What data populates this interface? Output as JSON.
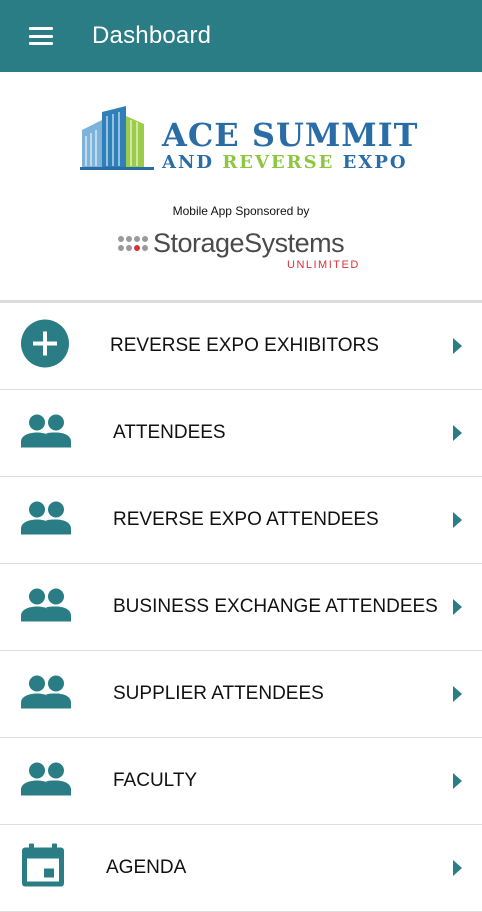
{
  "appbar": {
    "title": "Dashboard",
    "menu_icon": "hamburger-menu-icon",
    "background": "#2a7d85"
  },
  "banner": {
    "logo_title": "ACE SUMMIT",
    "logo_sub_and": "AND",
    "logo_sub_reverse": "REVERSE",
    "logo_sub_expo": "EXPO",
    "sponsor_label": "Mobile App Sponsored by",
    "sponsor_name": "StorageSystems",
    "sponsor_sub": "UNLIMITED",
    "colors": {
      "blue": "#2a6da6",
      "green": "#8dc63f",
      "red": "#d9303a"
    }
  },
  "menu": {
    "items": [
      {
        "label": "REVERSE EXPO EXHIBITORS",
        "icon": "add-circle-icon"
      },
      {
        "label": "ATTENDEES",
        "icon": "people-icon"
      },
      {
        "label": "REVERSE EXPO ATTENDEES",
        "icon": "people-icon"
      },
      {
        "label": "BUSINESS EXCHANGE ATTENDEES",
        "icon": "people-icon"
      },
      {
        "label": "SUPPLIER ATTENDEES",
        "icon": "people-icon"
      },
      {
        "label": "FACULTY",
        "icon": "people-icon"
      },
      {
        "label": "AGENDA",
        "icon": "calendar-icon"
      }
    ],
    "chevron_icon": "chevron-right-icon",
    "accent": "#2a7d85"
  }
}
